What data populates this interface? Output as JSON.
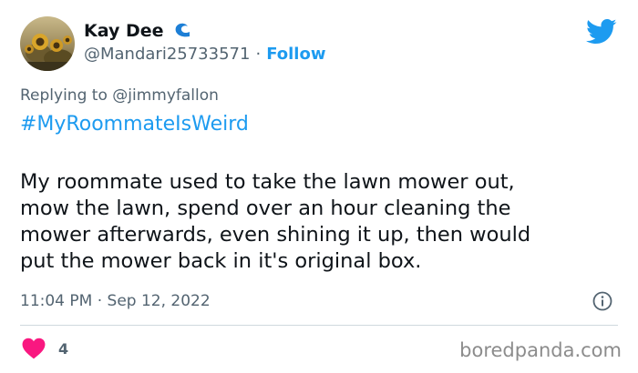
{
  "author": {
    "display_name": "Kay Dee",
    "name_icon": "wave-emoji",
    "handle": "@Mandari25733571",
    "separator": "·",
    "follow_label": "Follow",
    "avatar": "avatar-sunflowers"
  },
  "logo": "twitter-bird-icon",
  "reply_context": {
    "prefix": "Replying to",
    "mention": "@jimmyfallon"
  },
  "tweet": {
    "hashtag": "#MyRoommateIsWeird",
    "lines": [
      "My roommate used to take the lawn mower out,",
      "mow the lawn, spend over an hour cleaning the",
      "mower afterwards, even shining it up, then would",
      "put the mower back in it's original box."
    ],
    "timestamp": "11:04 PM · Sep 12, 2022"
  },
  "actions": {
    "like_count": "4",
    "info_icon": "info-icon",
    "heart_icon": "heart-icon"
  },
  "watermark": "boredpanda.com",
  "colors": {
    "accent": "#1d9bf0",
    "heart": "#f91880",
    "secondary_text": "#536471",
    "primary_text": "#0f1419"
  }
}
